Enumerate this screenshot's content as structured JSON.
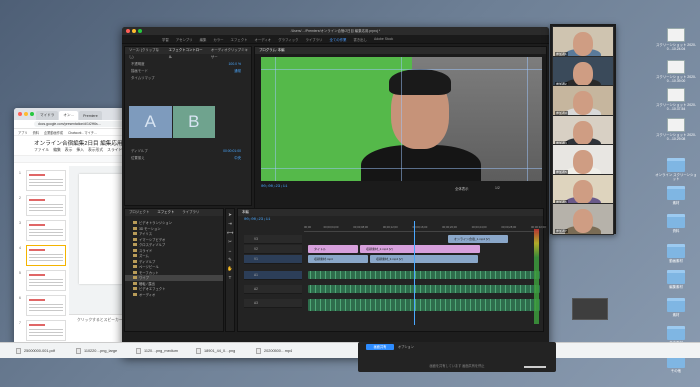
{
  "desktop": {
    "icons": [
      {
        "caption": "スクリーンショット 2020-0…10.24.04",
        "kind": "doc"
      },
      {
        "caption": "スクリーンショット 2020-0…10.39.00",
        "kind": "doc"
      },
      {
        "caption": "スクリーンショット 2020-0…10.37.54",
        "kind": "doc"
      },
      {
        "caption": "スクリーンショット 2020-0…10.29.08",
        "kind": "doc"
      },
      {
        "caption": "オンライン スクリーンショット",
        "kind": "folder"
      },
      {
        "caption": "素材",
        "kind": "folder"
      },
      {
        "caption": "資料",
        "kind": "folder"
      },
      {
        "caption": "動画素材",
        "kind": "folder"
      },
      {
        "caption": "編集素材",
        "kind": "folder"
      },
      {
        "caption": "素材",
        "kind": "folder"
      },
      {
        "caption": "音声素材",
        "kind": "folder"
      },
      {
        "caption": "その他",
        "kind": "folder"
      }
    ]
  },
  "slides": {
    "tabs": [
      "マイドラ",
      "オン…",
      "Premiere"
    ],
    "url": "docs.google.com/presentation/d/1t2H6s…",
    "bookmarks": [
      "アプリ",
      "資料",
      "企業動画作成",
      "Chatwork - マイチ…"
    ],
    "doc_title": "オンライン合宿編集2日目 編集応用",
    "menu": [
      "ファイル",
      "編集",
      "表示",
      "挿入",
      "表示形式",
      "スライド"
    ],
    "thumb_numbers": [
      "1",
      "2",
      "3",
      "4",
      "5",
      "6",
      "7",
      "8"
    ],
    "notes": "クリックするとスピーカー ノートを追加できます"
  },
  "premiere": {
    "window_title": "/Users/…/Premiere/オンライン合宿/2日目 編集応用.prproj *",
    "workspaces": [
      "学習",
      "アセンブリ",
      "編集",
      "カラー",
      "エフェクト",
      "オーディオ",
      "グラフィック",
      "ライブラリ",
      "全ての作業",
      "書き出し",
      "Adobe Stock"
    ],
    "active_workspace": "全ての作業",
    "fx_tabs": [
      "ソース: (クリップなし)",
      "エフェクトコントロール",
      "オーディオクリップミキサー"
    ],
    "fx_rows": [
      {
        "label": "不透明度",
        "value": "100.0 %"
      },
      {
        "label": "描画モード",
        "value": "通常"
      },
      {
        "label": "タイムリマップ",
        "value": ""
      },
      {
        "label": "ディゾルブ",
        "value": "00:00:01:00"
      },
      {
        "label": "位置揃え",
        "value": "中央"
      }
    ],
    "ab": [
      "A",
      "B"
    ],
    "program_title": "プログラム: 本編",
    "program_tc": "00;00;23;11",
    "fit": "全体表示",
    "fraction": "1/2",
    "project_tabs": [
      "プロジェクト",
      "エフェクト",
      "ライブラリ"
    ],
    "fx_list": [
      "ビデオトランジション",
      "3D モーション",
      "アイリス",
      "イマーシブビデオ",
      "クロスディゾルブ",
      "スライド",
      "ズーム",
      "ディゾルブ",
      "ページピール",
      "モーフカット",
      "ワイプ",
      "暗転 / 露出",
      "ビデオエフェクト",
      "オーディオ"
    ],
    "fx_list_selected": "ワイプ",
    "sequence_tab": "本編",
    "seq_tc": "00;00;23;11",
    "ruler": [
      "00;00",
      "00;00;04;00",
      "00;00;08;00",
      "00;00;12;00",
      "00;00;16;00",
      "00;00;20;00",
      "00;00;24;00",
      "00;00;28;00",
      "00;00;32;00"
    ],
    "tracks": [
      "V3",
      "V2",
      "V1",
      "A1",
      "A2",
      "A3"
    ],
    "clips": [
      {
        "track": 0,
        "label": "オンライン合宿_1.mp4 [V]",
        "color": "blue"
      },
      {
        "track": 1,
        "label": "タイトル",
        "color": "pink"
      },
      {
        "track": 1,
        "label": "収録素材_2.mp4 [V]",
        "color": "pink"
      },
      {
        "track": 2,
        "label": "収録素材.mp4",
        "color": "blue"
      },
      {
        "track": 2,
        "label": "収録素材_3.mp4 [V]",
        "color": "blue"
      }
    ],
    "status": "クリックして選択、または空のエリアをクリックしてドラッグして選択範囲を作成します。Shift キー、Opt キーまたは Cmd キーを使用すると、他のオプションを利用できます。"
  },
  "zoom": {
    "participants": [
      "参加者1",
      "参加者2",
      "参加者3",
      "参加者4",
      "参加者5",
      "参加者6",
      "参加者7"
    ],
    "share_label": "画面共有",
    "share_options": "オプション",
    "info": "画面を共有しています  画面共有を停止"
  },
  "downloads": [
    "25000000-001.pdf",
    "110220…png_large",
    "1120…png_medium",
    "18901_44_0…png",
    "20200500…mp4"
  ]
}
